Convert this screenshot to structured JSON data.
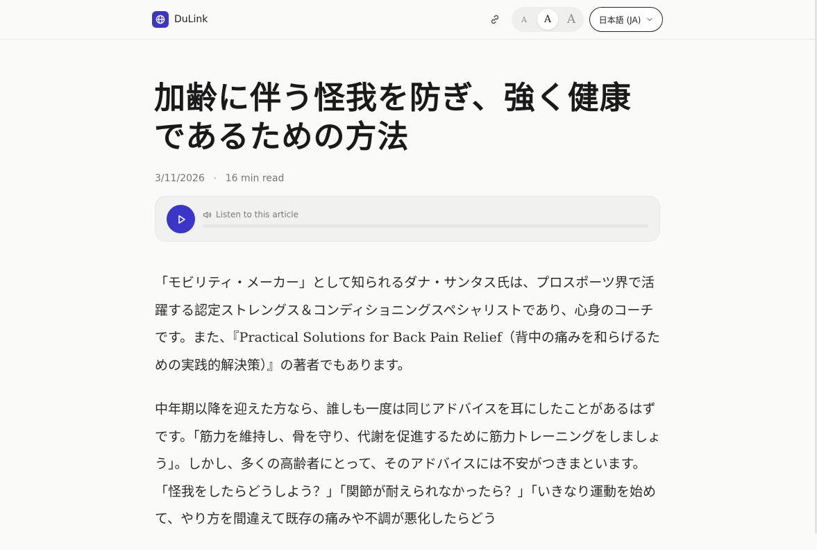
{
  "brand": {
    "name": "DuLink",
    "accent": "#3b35c9",
    "logo_icon": "globe-icon"
  },
  "toolbar": {
    "copy_link_icon": "link-icon",
    "font_sizes": [
      {
        "label": "A",
        "size": "small",
        "selected": false
      },
      {
        "label": "A",
        "size": "medium",
        "selected": true
      },
      {
        "label": "A",
        "size": "large",
        "selected": false
      }
    ],
    "language": {
      "selected": "日本語 (JA)",
      "icon": "chevron-down-icon"
    }
  },
  "article": {
    "title": "加齢に伴う怪我を防ぎ、強く健康であるための方法",
    "date": "3/11/2026",
    "separator": "•",
    "read_time": "16 min read",
    "player": {
      "label": "Listen to this article",
      "play_icon": "play-icon",
      "speaker_icon": "speaker-icon",
      "progress": 0
    },
    "paragraphs": [
      "「モビリティ・メーカー」として知られるダナ・サンタス氏は、プロスポーツ界で活躍する認定ストレングス＆コンディショニングスペシャリストであり、心身のコーチです。また、『Practical Solutions for Back Pain Relief（背中の痛みを和らげるための実践的解決策）』の著者でもあります。",
      "中年期以降を迎えた方なら、誰しも一度は同じアドバイスを耳にしたことがあるはずです。「筋力を維持し、骨を守り、代謝を促進するために筋力トレーニングをしましょう」。しかし、多くの高齢者にとって、そのアドバイスには不安がつきまといます。「怪我をしたらどうしよう？」「関節が耐えられなかったら？」「いきなり運動を始めて、やり方を間違えて既存の痛みや不調が悪化したらどう"
    ]
  }
}
